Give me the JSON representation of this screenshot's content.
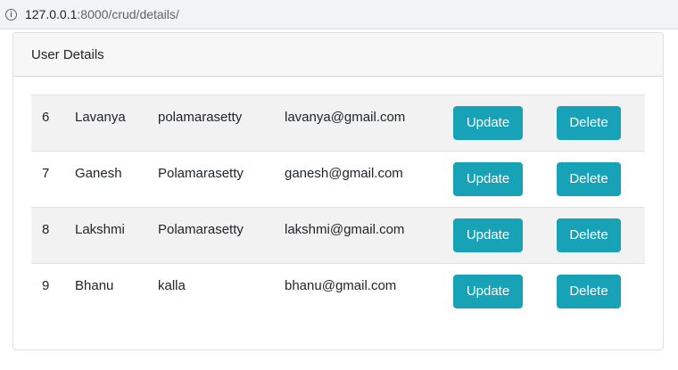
{
  "browser": {
    "url_host": "127.0.0.1",
    "url_rest": ":8000/crud/details/"
  },
  "card": {
    "header": "User Details"
  },
  "users": [
    {
      "id": "6",
      "first_name": "Lavanya",
      "last_name": "polamarasetty",
      "email": "lavanya@gmail.com",
      "update_label": "Update",
      "delete_label": "Delete"
    },
    {
      "id": "7",
      "first_name": "Ganesh",
      "last_name": "Polamarasetty",
      "email": "ganesh@gmail.com",
      "update_label": "Update",
      "delete_label": "Delete"
    },
    {
      "id": "8",
      "first_name": "Lakshmi",
      "last_name": "Polamarasetty",
      "email": "lakshmi@gmail.com",
      "update_label": "Update",
      "delete_label": "Delete"
    },
    {
      "id": "9",
      "first_name": "Bhanu",
      "last_name": "kalla",
      "email": "bhanu@gmail.com",
      "update_label": "Update",
      "delete_label": "Delete"
    }
  ],
  "colors": {
    "button_info": "#17a2b8",
    "stripe": "#f2f2f2"
  },
  "icons": {
    "address_bar": "info-icon"
  }
}
